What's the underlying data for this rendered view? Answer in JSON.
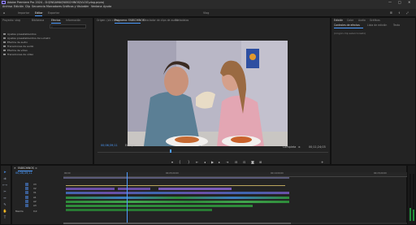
{
  "titlebar": {
    "title": "Adobe Premiere Pro 2024 - D:\\ENGAMA\\FABSCHINOS\\VLOG\\vlog.prproj",
    "minimize": "—",
    "maximize": "□",
    "close": "✕"
  },
  "menu": [
    "Archivo",
    "Edición",
    "Clip",
    "Secuencia",
    "Marcadores",
    "Gráficos y títulos",
    "Ver",
    "Ventana",
    "Ayuda"
  ],
  "workspace": {
    "tabs": [
      "Importar",
      "Editar",
      "Exportar"
    ],
    "active": "Editar",
    "center_title": "Vlog"
  },
  "project_panel": {
    "tabs": [
      "Proyecto: vlog",
      "Biblioteca",
      "Efectos",
      "Información"
    ],
    "active_tab": "Efectos",
    "search_placeholder": "",
    "items": [
      "Ajustes preestablecidos",
      "Ajustes preestablecidos de Lumetri",
      "Efectos de audio",
      "Transiciones de audio",
      "Efectos de vídeo",
      "Transiciones de vídeo"
    ]
  },
  "program_monitor": {
    "tabs": [
      "Origen: (sin clips)",
      "Programa: FABSCHINOS",
      "Mezclador de clips de audio",
      "Metadatos"
    ],
    "active_tab": "Programa: FABSCHINOS",
    "timecode_current": "00;06;39;11",
    "zoom": "Encajar",
    "quality": "Completa",
    "timecode_duration": "00;11;24;03"
  },
  "right_panel": {
    "tabs": [
      "Edición",
      "Color",
      "Audio",
      "Gráficos"
    ],
    "subtabs": [
      "Controles de efectos",
      "Lista de edición",
      "Texto"
    ],
    "active_subtab": "Controles de efectos",
    "empty_text": "(ningún clip seleccionado)"
  },
  "timeline": {
    "tab": "FABSCHINOS",
    "timecode": "00;06;39;11",
    "ruler_labels": [
      "00;00",
      "00;05;00;00",
      "00;10;00;00",
      "00;15;00;00"
    ],
    "tracks": [
      "V3",
      "V2",
      "V1",
      "A1",
      "A2",
      "A3"
    ],
    "mix_label": "Mezcla",
    "mix_value": "0,0"
  },
  "colors": {
    "accent": "#4d9cff",
    "video_clip": "#6b4fa8",
    "audio_clip": "#2e8b3a",
    "audio_clip_2": "#3c7bbf",
    "playhead": "#4d9cff"
  }
}
